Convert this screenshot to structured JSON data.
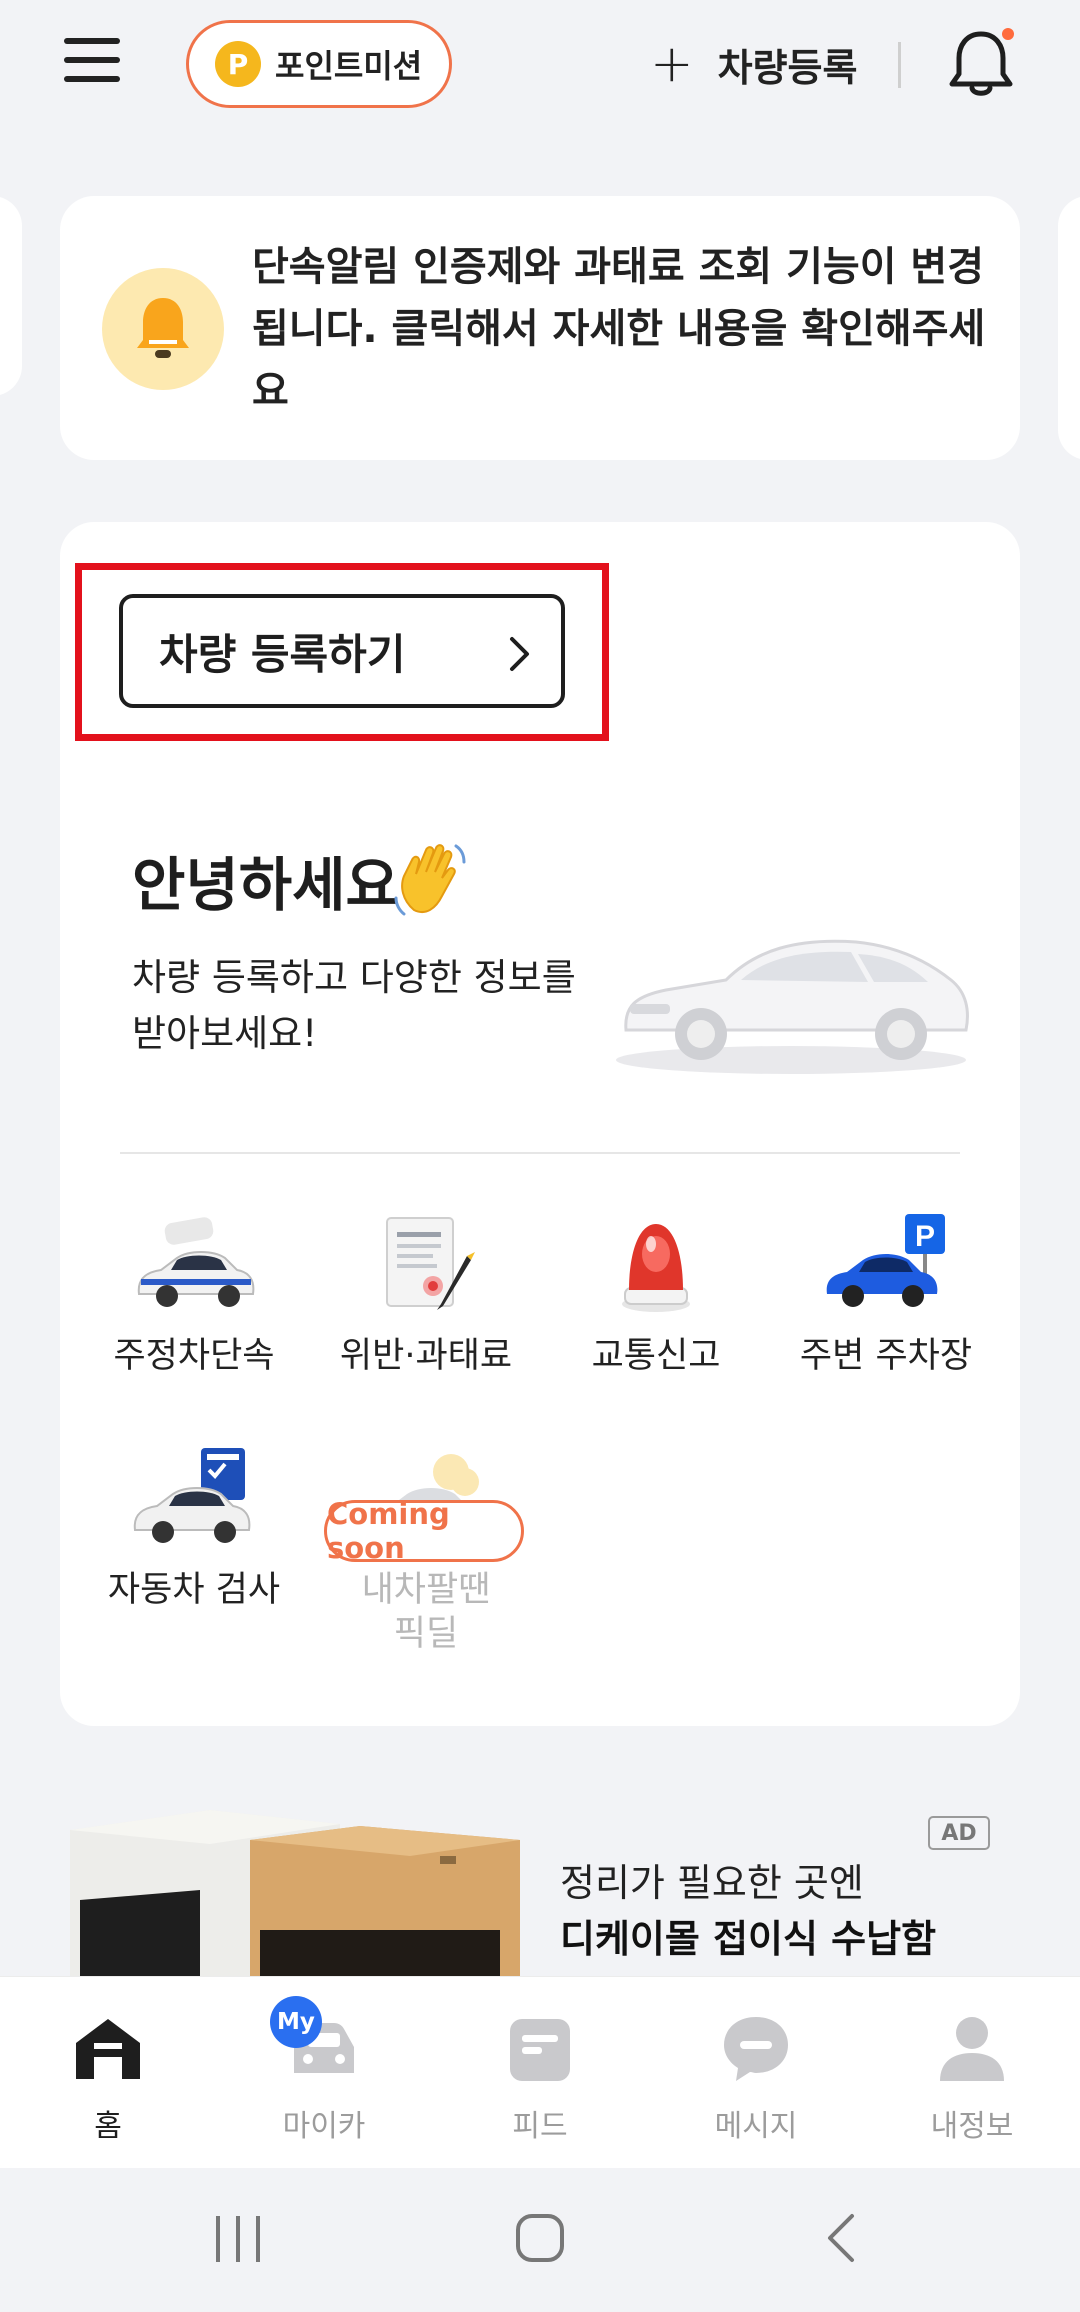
{
  "header": {
    "point_mission_label": "포인트미션",
    "point_icon_letter": "P",
    "add_car_label": "차량등록"
  },
  "notice": {
    "text": "단속알림 인증제와 과태료 조회 기능이 변경됩니다. 클릭해서 자세한 내용을 확인해주세요"
  },
  "main": {
    "register_button_label": "차량 등록하기",
    "greeting_title": "안녕하세요",
    "greeting_subtitle_line1": "차량 등록하고 다양한 정보를",
    "greeting_subtitle_line2": "받아보세요!",
    "services": [
      {
        "label": "주정차단속",
        "icon": "parking-enforcement-icon"
      },
      {
        "label": "위반·과태료",
        "icon": "fine-document-icon"
      },
      {
        "label": "교통신고",
        "icon": "siren-icon"
      },
      {
        "label": "주변 주차장",
        "icon": "nearby-parking-icon"
      },
      {
        "label": "자동차 검사",
        "icon": "car-inspection-icon"
      },
      {
        "label_line1": "내차팔땐",
        "label_line2": "픽딜",
        "icon": "car-sale-icon",
        "badge": "Coming soon"
      }
    ]
  },
  "ad": {
    "badge": "AD",
    "line1": "정리가 필요한 곳엔",
    "line2": "디케이몰 접이식 수납함"
  },
  "bottom_nav": {
    "items": [
      {
        "label": "홈",
        "icon": "home-icon",
        "active": true
      },
      {
        "label": "마이카",
        "icon": "my-car-icon",
        "badge": "My"
      },
      {
        "label": "피드",
        "icon": "feed-icon"
      },
      {
        "label": "메시지",
        "icon": "message-icon"
      },
      {
        "label": "내정보",
        "icon": "profile-icon"
      }
    ]
  },
  "colors": {
    "accent": "#f0734a",
    "highlight": "#e3111c",
    "badge_blue": "#2a6ff0",
    "bell_bg": "#fde9b0"
  }
}
